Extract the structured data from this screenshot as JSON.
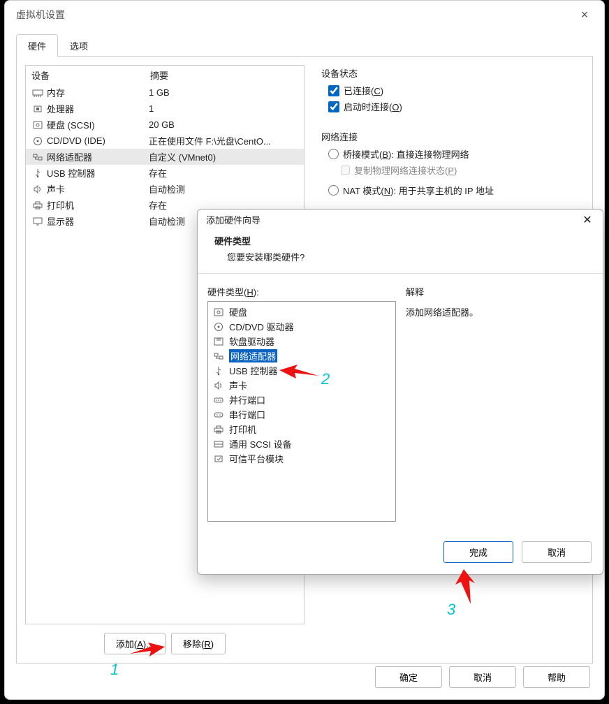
{
  "window": {
    "title": "虚拟机设置",
    "tabs": {
      "hardware": "硬件",
      "options": "选项"
    },
    "listHeader": {
      "device": "设备",
      "summary": "摘要"
    },
    "devices": [
      {
        "icon": "memory",
        "name": "内存",
        "summary": "1 GB"
      },
      {
        "icon": "cpu",
        "name": "处理器",
        "summary": "1"
      },
      {
        "icon": "disk",
        "name": "硬盘 (SCSI)",
        "summary": "20 GB"
      },
      {
        "icon": "cd",
        "name": "CD/DVD (IDE)",
        "summary": "正在使用文件 F:\\光盘\\CentO..."
      },
      {
        "icon": "net",
        "name": "网络适配器",
        "summary": "自定义 (VMnet0)",
        "selected": true
      },
      {
        "icon": "usb",
        "name": "USB 控制器",
        "summary": "存在"
      },
      {
        "icon": "sound",
        "name": "声卡",
        "summary": "自动检测"
      },
      {
        "icon": "printer",
        "name": "打印机",
        "summary": "存在"
      },
      {
        "icon": "display",
        "name": "显示器",
        "summary": "自动检测"
      }
    ],
    "buttons": {
      "add": "添加(A)...",
      "remove": "移除(R)"
    },
    "right": {
      "stateLabel": "设备状态",
      "connected": "已连接(C)",
      "connectOnStart": "启动时连接(O)",
      "netConnLabel": "网络连接",
      "bridge": "桥接模式(B): 直接连接物理网络",
      "replicate": "复制物理网络连接状态(P)",
      "nat": "NAT 模式(N): 用于共享主机的 IP 地址"
    },
    "footer": {
      "ok": "确定",
      "cancel": "取消",
      "help": "帮助"
    }
  },
  "modal": {
    "title": "添加硬件向导",
    "heading": "硬件类型",
    "sub": "您要安装哪类硬件?",
    "listLabel": "硬件类型(H):",
    "explainLabel": "解释",
    "explainText": "添加网络适配器。",
    "items": [
      {
        "icon": "disk",
        "label": "硬盘"
      },
      {
        "icon": "cd",
        "label": "CD/DVD 驱动器"
      },
      {
        "icon": "floppy",
        "label": "软盘驱动器"
      },
      {
        "icon": "net",
        "label": "网络适配器",
        "selected": true
      },
      {
        "icon": "usb",
        "label": "USB 控制器"
      },
      {
        "icon": "sound",
        "label": "声卡"
      },
      {
        "icon": "parallel",
        "label": "并行端口"
      },
      {
        "icon": "serial",
        "label": "串行端口"
      },
      {
        "icon": "printer",
        "label": "打印机"
      },
      {
        "icon": "scsi",
        "label": "通用 SCSI 设备"
      },
      {
        "icon": "tpm",
        "label": "可信平台模块"
      }
    ],
    "footer": {
      "finish": "完成",
      "cancel": "取消"
    }
  },
  "annotations": {
    "n1": "1",
    "n2": "2",
    "n3": "3"
  }
}
